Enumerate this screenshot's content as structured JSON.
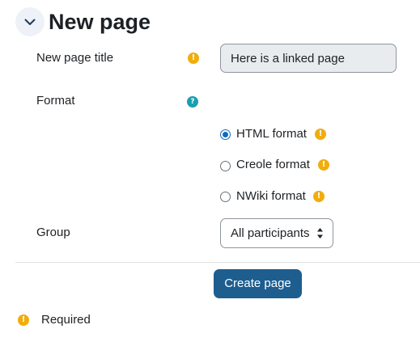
{
  "section": {
    "title": "New page"
  },
  "form": {
    "page_title": {
      "label": "New page title",
      "value": "Here is a linked page"
    },
    "format": {
      "label": "Format",
      "options": [
        {
          "label": "HTML format",
          "selected": true
        },
        {
          "label": "Creole format",
          "selected": false
        },
        {
          "label": "NWiki format",
          "selected": false
        }
      ]
    },
    "group": {
      "label": "Group",
      "selected": "All participants"
    },
    "submit_label": "Create page"
  },
  "footer": {
    "required_text": "Required"
  },
  "colors": {
    "primary": "#1e5e8f",
    "required_icon": "#f0ad0e",
    "help_icon": "#1a9fb0",
    "radio_selected": "#0f6cbf"
  },
  "icons": {
    "collapse": "chevron-down-icon",
    "required": "exclamation-circle-icon",
    "help": "question-circle-icon",
    "select": "sort-arrows-icon"
  }
}
